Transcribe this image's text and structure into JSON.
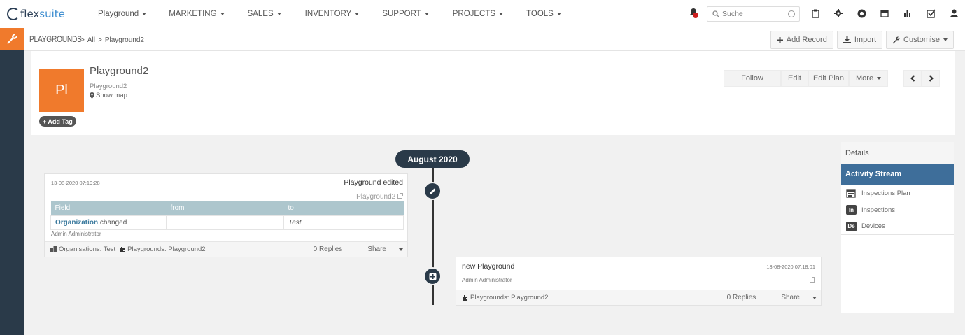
{
  "topnav": {
    "logo_flex": "flex",
    "logo_suite": "suite",
    "menu": [
      {
        "label": "Playground"
      },
      {
        "label": "MARKETING"
      },
      {
        "label": "SALES"
      },
      {
        "label": "INVENTORY"
      },
      {
        "label": "SUPPORT"
      },
      {
        "label": "PROJECTS"
      },
      {
        "label": "TOOLS"
      }
    ],
    "search_placeholder": "Suche",
    "icons": [
      "bell-icon",
      "clipboard-icon",
      "gear-icon",
      "plus-circle-icon",
      "calendar-icon",
      "bar-chart-icon",
      "checkbox-icon",
      "user-icon"
    ]
  },
  "breadcrumb": {
    "module": "PLAYGROUNDS",
    "all": "All",
    "current": "Playground2",
    "separator": ">"
  },
  "actions": {
    "add_record": "Add Record",
    "import": "Import",
    "customise": "Customise"
  },
  "record": {
    "initials": "Pl",
    "title": "Playground2",
    "subtitle": "Playground2",
    "show_map": "Show map",
    "add_tag": "+ Add Tag",
    "buttons": {
      "follow": "Follow",
      "edit": "Edit",
      "edit_plan": "Edit Plan",
      "more": "More"
    }
  },
  "timeline": {
    "month": "August 2020",
    "entries": [
      {
        "date": "13-08-2020 07:19:28",
        "title": "Playground edited",
        "link": "Playground2",
        "table_headers": [
          "Field",
          "from",
          "to"
        ],
        "row": {
          "field_link": "Organization",
          "field_suffix": " changed",
          "from": "",
          "to": "Test"
        },
        "author": "Admin Administrator",
        "tags": "Organisations: Test",
        "tags2": "Playgrounds: Playground2",
        "replies": "0 Replies",
        "share": "Share"
      },
      {
        "date": "13-08-2020 07:18:01",
        "title": "new Playground",
        "author": "Admin Administrator",
        "tags": "Playgrounds: Playground2",
        "replies": "0 Replies",
        "share": "Share"
      }
    ]
  },
  "details": {
    "header": "Details",
    "active": "Activity Stream",
    "items": [
      {
        "badge": "",
        "label": "Inspections Plan"
      },
      {
        "badge": "In",
        "label": "Inspections"
      },
      {
        "badge": "De",
        "label": "Devices"
      }
    ]
  },
  "colors": {
    "accent_orange": "#f07a2c",
    "nav_dark": "#2a3a49",
    "active_blue": "#3e6e9a",
    "table_header": "#adc6cd"
  }
}
